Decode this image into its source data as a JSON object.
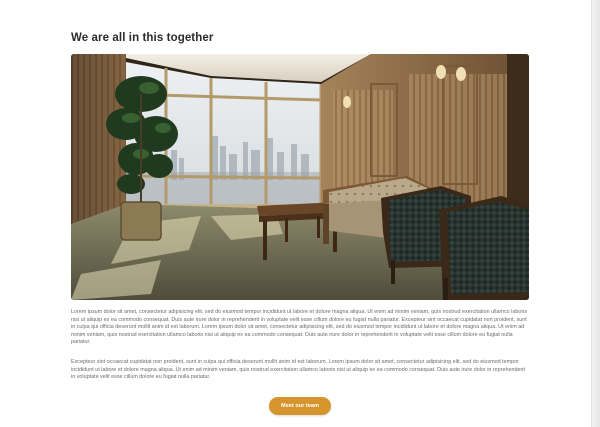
{
  "section": {
    "title": "We are all in this together",
    "image_alt": "Lounge with window view",
    "paragraphs": [
      "Lorem ipsum dolor sit amet, consectetur adipisicing elit, sed do eiusmod tempor incididunt ut labore et dolore magna aliqua. Ut enim ad minim veniam, quis nostrud exercitation ullamco laboris nisi ut aliquip ex ea commodo consequat. Duis aute irure dolor in reprehenderit in voluptate velit esse cillum dolore eu fugiat nulla pariatur. Excepteur sint occaecat cupidatat non proident, sunt in culpa qui officia deserunt mollit anim id est laborum. Lorem ipsum dolor sit amet, consectetur adipisicing elit, sed do eiusmod tempor incididunt ut labore et dolore magna aliqua. Ut enim ad minim veniam, quis nostrud exercitation ullamco laboris nisi ut aliquip ex ea commodo consequat. Duis aute irure dolor in reprehenderit in voluptate velit esse cillum dolore eu fugiat nulla pariatur.",
      "Excepteur sint occaecat cupidatat non proident, sunt in culpa qui officia deserunt mollit anim id est laborum. Lorem ipsum dolor sit amet, consectetur adipisicing elit, sed do eiusmod tempor incididunt ut labore et dolore magna aliqua. Ut enim ad minim veniam, quis nostrud exercitation ullamco laboris nisi ut aliquip ex ea commodo consequat. Duis aute irure dolor in reprehenderit in voluptate velit esse cillum dolore eu fugiat nulla pariatur."
    ],
    "cta_label": "Meet our team"
  },
  "colors": {
    "accent": "#d5942c",
    "heading": "#2b2b2b",
    "body_text": "#6b6b6b"
  }
}
